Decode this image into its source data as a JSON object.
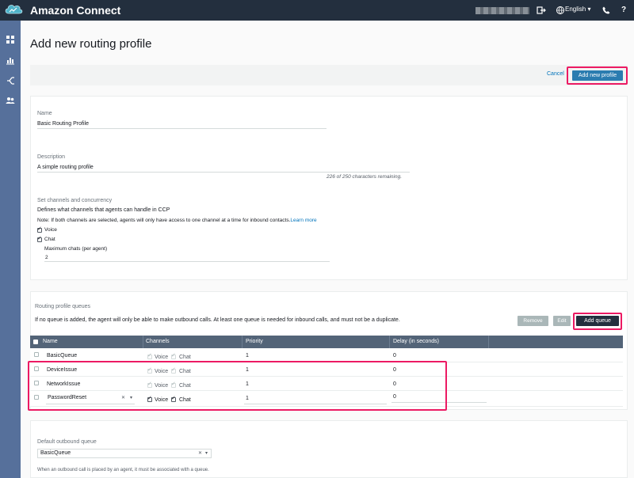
{
  "app": {
    "title": "Amazon Connect",
    "language": "English"
  },
  "page": {
    "title": "Add new routing profile",
    "cancel_label": "Cancel",
    "add_profile_label": "Add new profile"
  },
  "form": {
    "name_label": "Name",
    "name_value": "Basic Routing Profile",
    "description_label": "Description",
    "description_value": "A simple routing profile",
    "char_remaining": "226 of 250 characters remaining.",
    "channels_heading": "Set channels and concurrency",
    "channels_desc": "Defines what channels that agents can handle in CCP",
    "note": "Note: If both channels are selected, agents will only have access to one channel at a time for inbound contacts.",
    "learn_more": "Learn more",
    "voice_label": "Voice",
    "chat_label": "Chat",
    "max_chats_label": "Maximum chats (per agent)",
    "max_chats_value": "2"
  },
  "queues": {
    "heading": "Routing profile queues",
    "info": "If no queue is added, the agent will only be able to make outbound calls. At least one queue is needed for inbound calls, and must not be a duplicate.",
    "remove_label": "Remove",
    "edit_label": "Edit",
    "add_label": "Add queue",
    "columns": [
      "Name",
      "Channels",
      "Priority",
      "Delay (in seconds)"
    ],
    "rows": [
      {
        "name": "BasicQueue",
        "voice": "Voice",
        "chat": "Chat",
        "priority": "1",
        "delay": "0"
      },
      {
        "name": "DeviceIssue",
        "voice": "Voice",
        "chat": "Chat",
        "priority": "1",
        "delay": "0"
      },
      {
        "name": "NetworkIssue",
        "voice": "Voice",
        "chat": "Chat",
        "priority": "1",
        "delay": "0"
      },
      {
        "name": "PasswordReset",
        "voice": "Voice",
        "chat": "Chat",
        "priority": "1",
        "delay": "0"
      }
    ]
  },
  "outbound": {
    "label": "Default outbound queue",
    "value": "BasicQueue",
    "help": "When an outbound call is placed by an agent, it must be associated with a queue."
  },
  "colors": {
    "header": "#232f3e",
    "sidebar": "#56709b",
    "primary": "#2b7cb0",
    "highlight": "#ec1a63",
    "table_header": "#536478"
  },
  "icons": [
    "app-logo-icon",
    "logout-icon",
    "globe-icon",
    "phone-icon",
    "help-icon",
    "dashboard-icon",
    "metrics-icon",
    "routing-icon",
    "users-icon"
  ]
}
